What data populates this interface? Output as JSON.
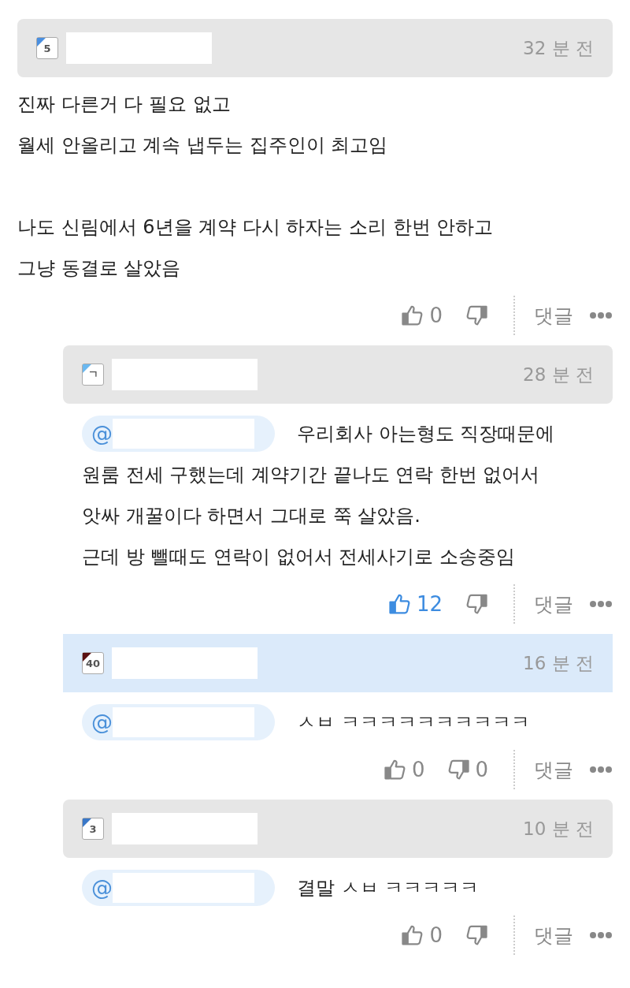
{
  "comments": [
    {
      "highlighted": false,
      "level": "5",
      "color": "#4a8fe0",
      "time": "32 분 전",
      "lines": [
        "진짜 다른거 다 필요 없고",
        "월세 안올리고 계속 냅두는 집주인이 최고임"
      ],
      "lines_2": [
        "나도 신림에서 6년을 계약 다시 하자는 소리 한번 안하고",
        "그냥 동결로 살았음"
      ],
      "likes": "0",
      "liked": false,
      "reply_label": "댓글",
      "replies": [
        {
          "highlighted": false,
          "level": "ㄱ",
          "color": "#6ab8f0",
          "time": "28 분 전",
          "mention": "@",
          "lines": [
            "우리회사 아는형도 직장때문에",
            "원룸 전세 구했는데 계약기간 끝나도 연락 한번 없어서",
            "앗싸 개꿀이다 하면서 그대로 쭉 살았음.",
            "근데 방 뺄때도 연락이 없어서 전세사기로 소송중임"
          ],
          "likes": "12",
          "liked": true,
          "reply_label": "댓글"
        },
        {
          "highlighted": true,
          "level": "40",
          "color": "#5a1010",
          "time": "16 분 전",
          "mention": "@",
          "lines": [
            "ㅅㅂ ㅋㅋㅋㅋㅋㅋㅋㅋㅋㅋ"
          ],
          "likes": "0",
          "liked": false,
          "dislikes": "0",
          "reply_label": "댓글"
        },
        {
          "highlighted": false,
          "level": "3",
          "color": "#3a78c8",
          "time": "10 분 전",
          "mention": "@",
          "lines": [
            "결말 ㅅㅂ ㅋㅋㅋㅋㅋ"
          ],
          "likes": "0",
          "liked": false,
          "reply_label": "댓글"
        }
      ]
    }
  ]
}
